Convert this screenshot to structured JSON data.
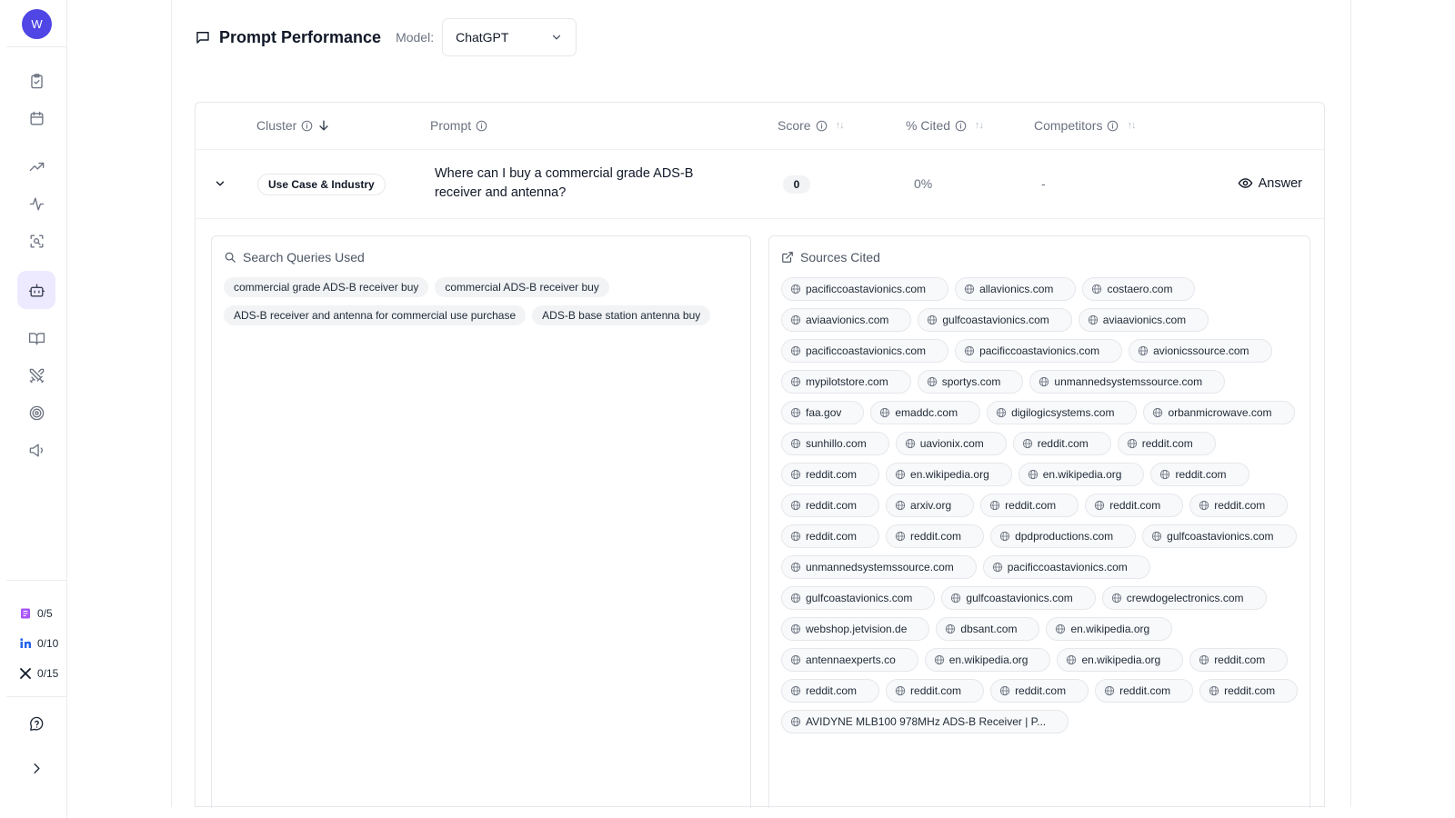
{
  "sidebar": {
    "avatar_initial": "W",
    "nav_icons": [
      "clipboard-check-icon",
      "calendar-icon",
      "trending-up-icon",
      "activity-icon",
      "scan-search-icon",
      "bot-icon",
      "book-open-icon",
      "swords-icon",
      "target-icon",
      "megaphone-icon"
    ],
    "active_item": "bot-icon",
    "quotas": [
      {
        "icon": "notes-quota-icon",
        "value": "0/5"
      },
      {
        "icon": "linkedin-quota-icon",
        "value": "0/10"
      },
      {
        "icon": "x-quota-icon",
        "value": "0/15"
      }
    ],
    "footer_icons": [
      "help-circle-icon",
      "chevron-right-icon"
    ]
  },
  "header": {
    "title": "Prompt Performance",
    "model_label": "Model:",
    "model_value": "ChatGPT"
  },
  "table": {
    "columns": {
      "cluster": "Cluster",
      "prompt": "Prompt",
      "score": "Score",
      "cited": "% Cited",
      "competitors": "Competitors"
    },
    "row": {
      "cluster": "Use Case & Industry",
      "prompt": "Where can I buy a commercial grade ADS-B receiver and antenna?",
      "score": "0",
      "cited": "0%",
      "competitors": "-",
      "answer_label": "Answer"
    }
  },
  "search_queries": {
    "title": "Search Queries Used",
    "items": [
      "commercial grade ADS-B receiver buy",
      "commercial ADS-B receiver buy",
      "ADS-B receiver and antenna for commercial use purchase",
      "ADS-B base station antenna buy"
    ]
  },
  "sources": {
    "title": "Sources Cited",
    "items": [
      "pacificcoastavionics.com",
      "allavionics.com",
      "costaero.com",
      "aviaavionics.com",
      "gulfcoastavionics.com",
      "aviaavionics.com",
      "pacificcoastavionics.com",
      "pacificcoastavionics.com",
      "avionicssource.com",
      "mypilotstore.com",
      "sportys.com",
      "unmannedsystemssource.com",
      "faa.gov",
      "emaddc.com",
      "digilogicsystems.com",
      "orbanmicrowave.com",
      "sunhillo.com",
      "uavionix.com",
      "reddit.com",
      "reddit.com",
      "reddit.com",
      "en.wikipedia.org",
      "en.wikipedia.org",
      "reddit.com",
      "reddit.com",
      "arxiv.org",
      "reddit.com",
      "reddit.com",
      "reddit.com",
      "reddit.com",
      "reddit.com",
      "dpdproductions.com",
      "gulfcoastavionics.com",
      "unmannedsystemssource.com",
      "pacificcoastavionics.com",
      "gulfcoastavionics.com",
      "gulfcoastavionics.com",
      "crewdogelectronics.com",
      "webshop.jetvision.de",
      "dbsant.com",
      "en.wikipedia.org",
      "antennaexperts.co",
      "en.wikipedia.org",
      "en.wikipedia.org",
      "reddit.com",
      "reddit.com",
      "reddit.com",
      "reddit.com",
      "reddit.com",
      "reddit.com",
      "AVIDYNE MLB100 978MHz ADS-B Receiver | P..."
    ]
  }
}
